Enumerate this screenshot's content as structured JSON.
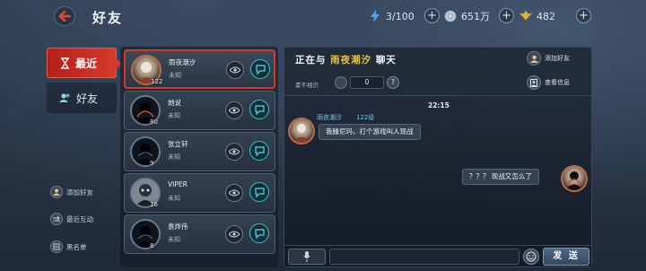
{
  "header": {
    "title": "好友",
    "resources": [
      {
        "icon": "lightning-icon",
        "value": "3/100"
      },
      {
        "icon": "silver-coin-icon",
        "value": "651万"
      },
      {
        "icon": "gold-wings-icon",
        "value": "482"
      }
    ]
  },
  "left_tabs": {
    "recent": "最近",
    "friends": "好友"
  },
  "side_links": {
    "add_friend": "添加好友",
    "recent_interaction": "最近互动",
    "blacklist": "黑名单"
  },
  "friends": [
    {
      "name": "雨夜潮汐",
      "status": "未知",
      "level": "122",
      "selected": true
    },
    {
      "name": "她说",
      "status": "未知",
      "level": "80",
      "selected": false
    },
    {
      "name": "张立轩",
      "status": "未知",
      "level": "9",
      "selected": false
    },
    {
      "name": "VIPER",
      "status": "未知",
      "level": "16",
      "selected": false
    },
    {
      "name": "袁烨伟",
      "status": "未知",
      "level": "8",
      "selected": false
    }
  ],
  "chat": {
    "title_prefix": "正在与",
    "title_name": "雨夜潮汐",
    "title_suffix": "聊天",
    "relation": "素不相识",
    "intimacy": "0",
    "help": "?",
    "add_friend": "添加好友",
    "view_info": "查看信息",
    "time": "22:15",
    "sender_name": "雨夜潮汐",
    "sender_level": "122级",
    "received_message": "我滕尼玛，打个游戏叫人现战",
    "sent_message": "？？？ 现战又怎么了",
    "input_placeholder": "",
    "send": "发 送"
  },
  "colors": {
    "accent_red": "#d23a2e",
    "highlight_gold": "#e6c34a",
    "sender_blue": "#66c7e6",
    "chat_button_cyan": "#3fc0d5"
  }
}
